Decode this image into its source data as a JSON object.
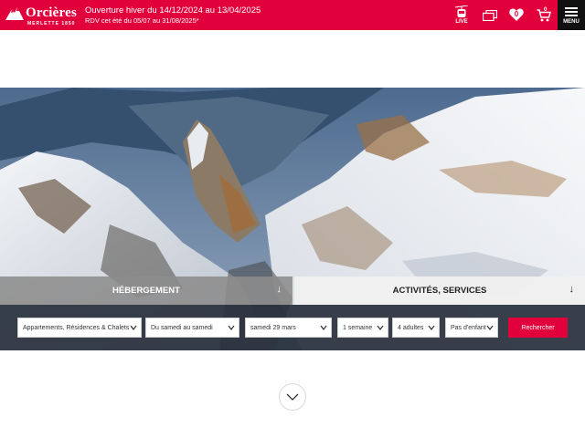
{
  "brand": {
    "name": "Orcières",
    "subtitle": "MERLETTE 1850",
    "color": "#e2003c"
  },
  "announcement": {
    "line1": "Ouverture hiver du 14/12/2024 au 13/04/2025",
    "line2": "RDV cet été du 05/07 au 31/08/2025*"
  },
  "header_icons": {
    "live_label": "LIVE",
    "favorites_count": "0",
    "cart_count": "0",
    "menu_label": "MENU"
  },
  "tabs": [
    {
      "label": "HÉBERGEMENT",
      "active": true
    },
    {
      "label": "ACTIVITÉS, SERVICES",
      "active": false
    }
  ],
  "search": {
    "type": "Appartements, Résidences & Chalets",
    "period": "Du samedi au samedi",
    "date": "samedi 29 mars",
    "duration": "1 semaine",
    "adults": "4 adultes",
    "children": "Pas d'enfant",
    "submit_label": "Rechercher"
  }
}
